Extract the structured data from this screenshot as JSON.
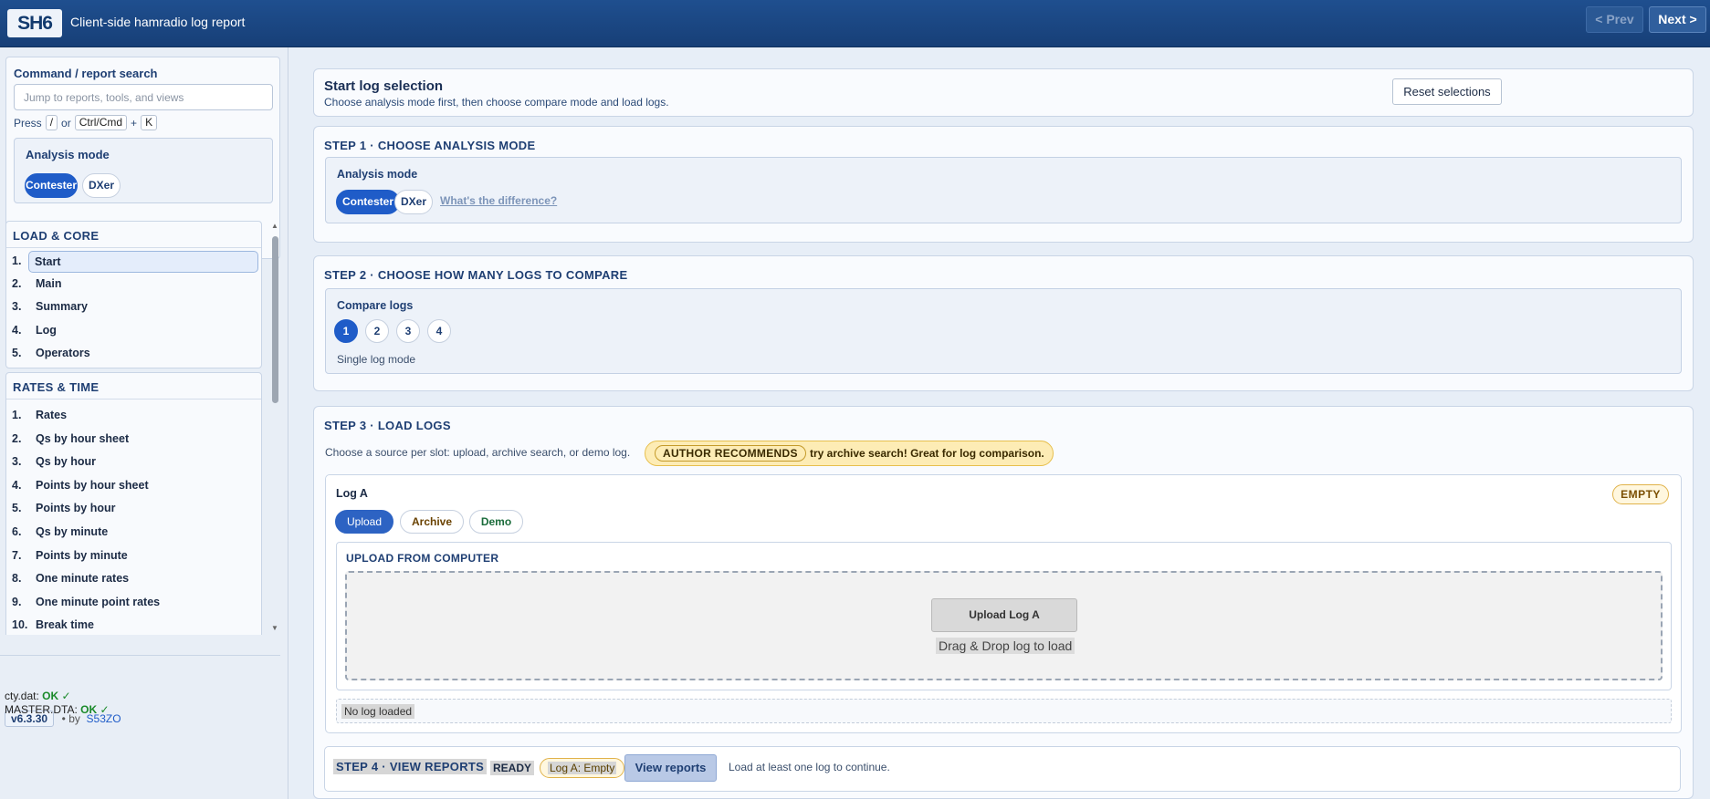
{
  "header": {
    "logo": "SH6",
    "title": "Client-side hamradio log report",
    "prev_label": "< Prev",
    "next_label": "Next >"
  },
  "sidebar": {
    "search_label": "Command / report search",
    "search_placeholder": "Jump to reports, tools, and views",
    "hint": {
      "press": "Press",
      "key1": "/",
      "or": "or",
      "key2": "Ctrl/Cmd",
      "plus": "+",
      "key3": "K"
    },
    "analysis_mode": {
      "title": "Analysis mode",
      "options": [
        "Contester",
        "DXer"
      ],
      "selected": "Contester"
    },
    "groups": [
      {
        "title": "LOAD & CORE",
        "items": [
          {
            "num": "1.",
            "label": "Start",
            "active": true
          },
          {
            "num": "2.",
            "label": "Main"
          },
          {
            "num": "3.",
            "label": "Summary"
          },
          {
            "num": "4.",
            "label": "Log"
          },
          {
            "num": "5.",
            "label": "Operators"
          }
        ]
      },
      {
        "title": "RATES & TIME",
        "items": [
          {
            "num": "1.",
            "label": "Rates"
          },
          {
            "num": "2.",
            "label": "Qs by hour sheet"
          },
          {
            "num": "3.",
            "label": "Qs by hour"
          },
          {
            "num": "4.",
            "label": "Points by hour sheet"
          },
          {
            "num": "5.",
            "label": "Points by hour"
          },
          {
            "num": "6.",
            "label": "Qs by minute"
          },
          {
            "num": "7.",
            "label": "Points by minute"
          },
          {
            "num": "8.",
            "label": "One minute rates"
          },
          {
            "num": "9.",
            "label": "One minute point rates"
          },
          {
            "num": "10.",
            "label": "Break time"
          }
        ]
      }
    ],
    "footer": {
      "version": "v6.3.30",
      "by": "by",
      "author": "S53ZO",
      "cty_label": "cty.dat:",
      "cty_status": "OK",
      "master_label": "MASTER.DTA:",
      "master_status": "OK",
      "check": "✓"
    }
  },
  "main": {
    "start": {
      "title": "Start log selection",
      "subtitle": "Choose analysis mode first, then choose compare mode and load logs.",
      "reset_label": "Reset selections"
    },
    "step1": {
      "title": "STEP 1 · CHOOSE ANALYSIS MODE",
      "box_title": "Analysis mode",
      "options": [
        "Contester",
        "DXer"
      ],
      "link": "What's the difference?"
    },
    "step2": {
      "title": "STEP 2 · CHOOSE HOW MANY LOGS TO COMPARE",
      "box_title": "Compare logs",
      "options": [
        "1",
        "2",
        "3",
        "4"
      ],
      "selected": "1",
      "mode_text": "Single log mode"
    },
    "step3": {
      "title": "STEP 3 · LOAD LOGS",
      "desc": "Choose a source per slot: upload, archive search, or demo log.",
      "rec_tag": "AUTHOR RECOMMENDS",
      "rec_text": "try archive search! Great for log comparison.",
      "slot": {
        "title": "Log A",
        "status": "EMPTY",
        "sources": [
          "Upload",
          "Archive",
          "Demo"
        ],
        "upload_title": "UPLOAD FROM COMPUTER",
        "upload_button": "Upload Log A",
        "drop_text": "Drag & Drop log to load",
        "no_log": "No log loaded"
      }
    },
    "step4": {
      "title": "STEP 4 · VIEW REPORTS",
      "ready": "READY",
      "badge": "Log A: Empty",
      "button": "View reports",
      "hint": "Load at least one log to continue."
    }
  },
  "colors": {
    "brand": "#1f4f8f",
    "accent": "#1f5cc8",
    "warning": "#fdecb5",
    "ok": "#1a8a2a"
  }
}
